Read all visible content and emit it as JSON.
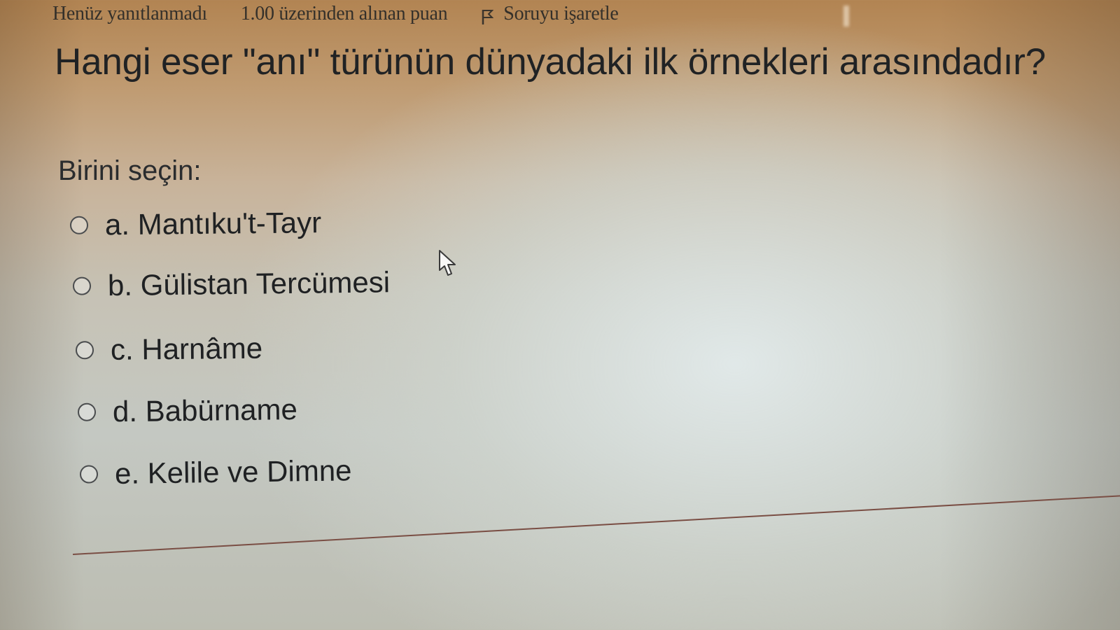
{
  "info_bar": {
    "status": "Henüz yanıtlanmadı",
    "grade": "1.00 üzerinden alınan puan",
    "flag_label": "Soruyu işaretle",
    "flag_icon": "flag-icon"
  },
  "question": {
    "text": "Hangi eser \"anı\" türünün dünyadaki ilk örnekleri arasındadır?",
    "prompt": "Birini seçin:"
  },
  "answers": [
    {
      "label": "a. Mantıku't-Tayr",
      "selected": false
    },
    {
      "label": "b. Gülistan Tercümesi",
      "selected": false
    },
    {
      "label": "c. Harnâme",
      "selected": false
    },
    {
      "label": "d. Babürname",
      "selected": false
    },
    {
      "label": "e. Kelile ve Dimne",
      "selected": false
    }
  ],
  "colors": {
    "text": "#1f2123",
    "divider": "#7a4e44",
    "top_warm": "#b28452",
    "center_light": "#e1e9e9"
  }
}
